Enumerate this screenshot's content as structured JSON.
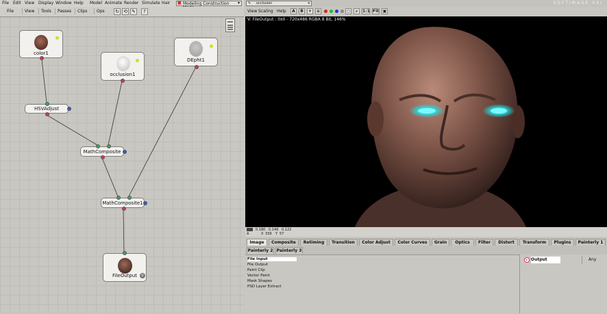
{
  "menu": {
    "items": [
      "File",
      "Edit",
      "View",
      "Display",
      "Window",
      "Help",
      "Model",
      "Animate",
      "Render",
      "Simulate",
      "Hair"
    ],
    "mode": "Modeling Construction Mode"
  },
  "toolbar": {
    "items": [
      "File",
      "View",
      "Tools",
      "Passes",
      "Clips",
      "Ops"
    ]
  },
  "nodes": {
    "color1": "color1",
    "occlusion1": "occlusion1",
    "depth1": "DEpht1",
    "hsv": "HSVAdjust",
    "math1": "MathComposite",
    "math2": "MathComposite1",
    "fileoutput": "FileOutput"
  },
  "viewer": {
    "clip": "occlusion",
    "menu": [
      "View",
      "Scaling",
      "Help"
    ],
    "brand": "SOFTIMAGE XSI",
    "title": "V: FileOutput : 0x0 - 720x486 RGBA 8 Bit, 146%",
    "fit_label": "Fit",
    "one_label": "1:1",
    "ab_a": "A",
    "ab_b": "B"
  },
  "pixel": {
    "r": "0.180",
    "g": "0.149",
    "b": "0.122",
    "a": "A",
    "x_label": "X",
    "x": "339",
    "y_label": "Y",
    "y": "57"
  },
  "tabs_row1": [
    "Image",
    "Composite",
    "Retiming",
    "Transition",
    "Color Adjust",
    "Color Curves",
    "Grain",
    "Optics",
    "Filter",
    "Distort",
    "Transform",
    "Plugins",
    "Painterly 1"
  ],
  "tabs_row2": [
    "Painterly 2",
    "Painterly 3"
  ],
  "tools": [
    "File Input",
    "File Output",
    "Paint Clip",
    "Vector Paint",
    "Mask Shapes",
    "PSD Layer Extract"
  ],
  "right_panel": {
    "output_label": "Output",
    "any_label": "Any"
  },
  "colors": {
    "port_out": "#d8345a",
    "port_in": "#3aa65f",
    "port_blue": "#3e56c8",
    "eye_glow": "#19e6f0"
  }
}
